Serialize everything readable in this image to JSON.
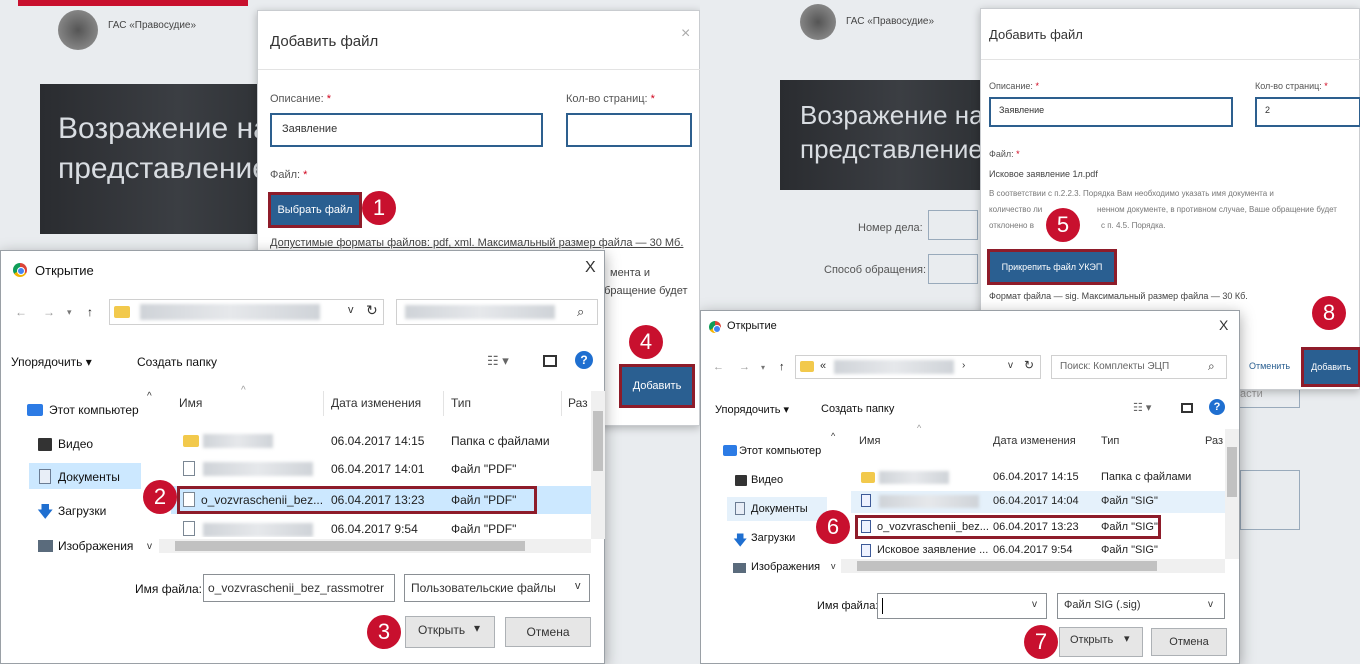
{
  "left": {
    "site_title": "ГАС «Правосудие»",
    "hero_line1": "Возражение на",
    "hero_line2": "представление",
    "modal": {
      "title": "Добавить файл",
      "close": "×",
      "desc_label": "Описание:",
      "desc_value": "Заявление",
      "pages_label": "Кол-во страниц:",
      "file_label": "Файл:",
      "choose_btn": "Выбрать файл",
      "formats": "Допустимые форматы файлов: pdf, xml. Максимальный размер файла — 30 Мб.",
      "frag1": "мента и",
      "frag2": "обращение будет",
      "add_btn": "Добавить"
    },
    "dialog": {
      "title": "Открытие",
      "close": "X",
      "organize": "Упорядочить ▾",
      "new_folder": "Создать папку",
      "nav": [
        "Этот компьютер",
        "Видео",
        "Документы",
        "Загрузки",
        "Изображения"
      ],
      "cols": [
        "Имя",
        "Дата изменения",
        "Тип",
        "Раз"
      ],
      "rows": [
        {
          "name": "",
          "date": "06.04.2017 14:15",
          "type": "Папка с файлами"
        },
        {
          "name": "",
          "date": "06.04.2017 14:01",
          "type": "Файл \"PDF\""
        },
        {
          "name": "o_vozvraschenii_bez...",
          "date": "06.04.2017 13:23",
          "type": "Файл \"PDF\""
        },
        {
          "name": "",
          "date": "06.04.2017 9:54",
          "type": "Файл \"PDF\""
        }
      ],
      "filename_label": "Имя файла:",
      "filename_value": "o_vozvraschenii_bez_rassmotrer",
      "filter": "Пользовательские файлы",
      "open": "Открыть",
      "cancel": "Отмена"
    }
  },
  "right": {
    "site_title": "ГАС «Правосудие»",
    "hero_line1": "Возражение на",
    "hero_line2": "представление",
    "case_label": "Номер дела:",
    "method_label": "Способ обращения:",
    "modal": {
      "title": "Добавить файл",
      "desc_label": "Описание:",
      "desc_value": "Заявление",
      "pages_label": "Кол-во страниц:",
      "pages_value": "2",
      "file_label": "Файл:",
      "file_name": "Исковое заявление 1л.pdf",
      "info1": "В соответствии с п.2.2.3. Порядка Вам необходимо указать имя документа и",
      "info2": "количество ли",
      "info2b": "ненном документе, в противном случае, Ваше обращение будет",
      "info3": "отклонено в",
      "info3b": "с п. 4.5. Порядка.",
      "attach_btn": "Прикрепить файл УКЭП",
      "sig_format": "Формат файла — sig. Максимальный размер файла — 30 Кб.",
      "cancel_link": "Отменить",
      "add_btn": "Добавить",
      "frag": "асти"
    },
    "dialog": {
      "title": "Открытие",
      "close": "X",
      "path_prefix": "«",
      "search": "Поиск: Комплекты ЭЦП",
      "organize": "Упорядочить ▾",
      "new_folder": "Создать папку",
      "nav": [
        "Этот компьютер",
        "Видео",
        "Документы",
        "Загрузки",
        "Изображения"
      ],
      "cols": [
        "Имя",
        "Дата изменения",
        "Тип",
        "Раз"
      ],
      "rows": [
        {
          "name": "",
          "date": "06.04.2017 14:15",
          "type": "Папка с файлами"
        },
        {
          "name": "",
          "date": "06.04.2017 14:04",
          "type": "Файл \"SIG\""
        },
        {
          "name": "o_vozvraschenii_bez...",
          "date": "06.04.2017 13:23",
          "type": "Файл \"SIG\""
        },
        {
          "name": "Исковое заявление ...",
          "date": "06.04.2017 9:54",
          "type": "Файл \"SIG\""
        }
      ],
      "filename_label": "Имя файла:",
      "filter": "Файл SIG (.sig)",
      "open": "Открыть",
      "cancel": "Отмена"
    }
  },
  "steps": [
    "1",
    "2",
    "3",
    "4",
    "5",
    "6",
    "7",
    "8"
  ],
  "colors": {
    "step_badge": "#c8102e",
    "highlight": "#8e1c2a",
    "primary": "#2a5f91"
  }
}
